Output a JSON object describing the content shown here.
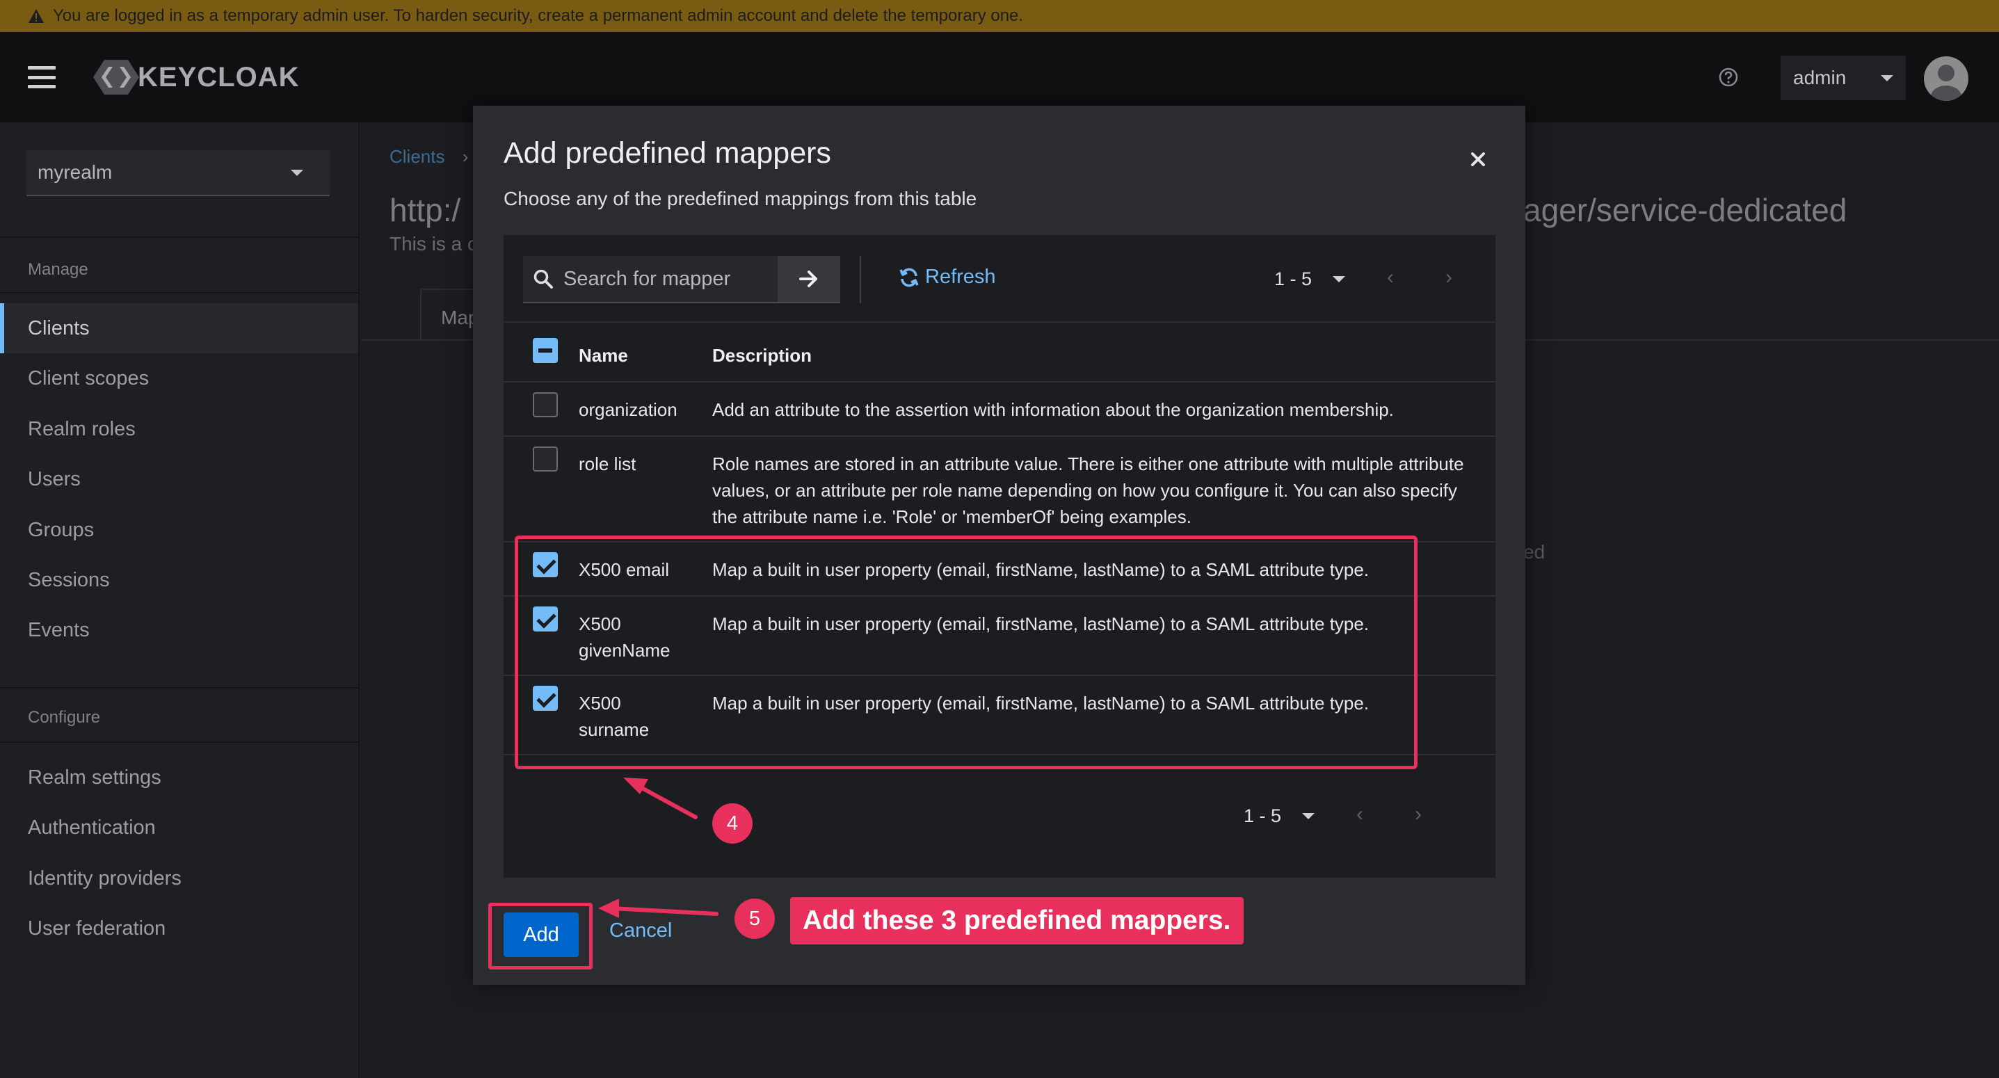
{
  "banner": {
    "icon": "warning-icon",
    "text": "You are logged in as a temporary admin user. To harden security, create a permanent admin account and delete the temporary one."
  },
  "masthead": {
    "logo_text": "KEYCLOAK",
    "help_icon": "question-circle-icon",
    "user": "admin"
  },
  "sidebar": {
    "realm": "myrealm",
    "manage_label": "Manage",
    "manage_items": [
      {
        "label": "Clients",
        "active": true
      },
      {
        "label": "Client scopes"
      },
      {
        "label": "Realm roles"
      },
      {
        "label": "Users"
      },
      {
        "label": "Groups"
      },
      {
        "label": "Sessions"
      },
      {
        "label": "Events"
      }
    ],
    "configure_label": "Configure",
    "configure_items": [
      {
        "label": "Realm settings"
      },
      {
        "label": "Authentication"
      },
      {
        "label": "Identity providers"
      },
      {
        "label": "User federation"
      }
    ]
  },
  "background": {
    "breadcrumb": "Clients",
    "title_left": "http:/",
    "title_right": "ager/service-dedicated",
    "subtitle": "This is a c",
    "tab": "Map",
    "fragment": "ed"
  },
  "modal": {
    "title": "Add predefined mappers",
    "description": "Choose any of the predefined mappings from this table",
    "search_placeholder": "Search for mapper",
    "refresh_label": "Refresh",
    "pagination": "1 - 5",
    "columns": {
      "name": "Name",
      "description": "Description"
    },
    "rows": [
      {
        "name": "organization",
        "description": "Add an attribute to the assertion with information about the organization membership.",
        "checked": false
      },
      {
        "name": "role list",
        "description": "Role names are stored in an attribute value. There is either one attribute with multiple attribute values, or an attribute per role name depending on how you configure it. You can also specify the attribute name i.e. 'Role' or 'memberOf' being examples.",
        "checked": false
      },
      {
        "name": "X500 email",
        "description": "Map a built in user property (email, firstName, lastName) to a SAML attribute type.",
        "checked": true
      },
      {
        "name": "X500 givenName",
        "description": "Map a built in user property (email, firstName, lastName) to a SAML attribute type.",
        "checked": true
      },
      {
        "name": "X500 surname",
        "description": "Map a built in user property (email, firstName, lastName) to a SAML attribute type.",
        "checked": true
      }
    ],
    "add_label": "Add",
    "cancel_label": "Cancel"
  },
  "annotations": {
    "step4": "4",
    "step5": "5",
    "callout": "Add these 3 predefined mappers.",
    "highlight_color": "#e8305c"
  },
  "colors": {
    "accent": "#73bcf7",
    "primary_button": "#0066cc",
    "banner": "#795b12"
  }
}
